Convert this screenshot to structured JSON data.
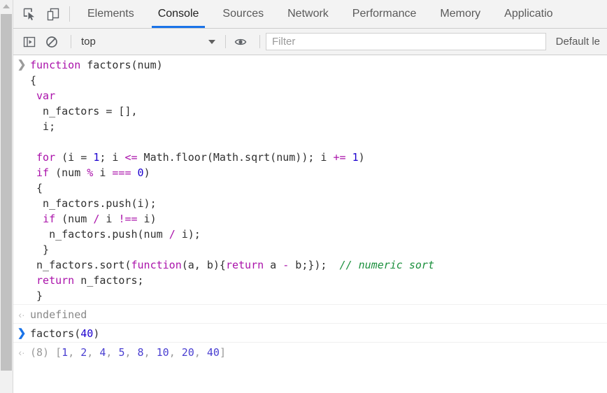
{
  "window": {
    "app": "Chrome DevTools"
  },
  "scrollbar": {
    "up_arrow_icon": "triangle-up-icon",
    "thumb": "scrollbar-thumb"
  },
  "tabbar": {
    "inspect_icon": "inspect-element-icon",
    "device_icon": "device-toolbar-icon",
    "tabs": [
      {
        "label": "Elements",
        "active": false
      },
      {
        "label": "Console",
        "active": true
      },
      {
        "label": "Sources",
        "active": false
      },
      {
        "label": "Network",
        "active": false
      },
      {
        "label": "Performance",
        "active": false
      },
      {
        "label": "Memory",
        "active": false
      },
      {
        "label": "Applicatio",
        "active": false
      }
    ],
    "active_underline_color": "#1a73e8"
  },
  "toolbar": {
    "sidebar_icon": "console-sidebar-icon",
    "clear_icon": "clear-console-icon",
    "context_selected": "top",
    "context_caret_icon": "chevron-down-icon",
    "eye_icon": "live-expression-eye-icon",
    "filter_placeholder": "Filter",
    "filter_value": "",
    "levels_label": "Default le"
  },
  "console": {
    "messages": [
      {
        "kind": "input",
        "prompt": "❯",
        "prompt_style": "gray",
        "lines": [
          [
            {
              "t": "function ",
              "c": "kw"
            },
            {
              "t": "factors(num)",
              "c": "pun"
            }
          ],
          [
            {
              "t": "{",
              "c": "pun"
            }
          ],
          [
            {
              "t": " ",
              "c": "pun"
            },
            {
              "t": "var",
              "c": "kw"
            }
          ],
          [
            {
              "t": "  n_factors = [],",
              "c": "pun"
            }
          ],
          [
            {
              "t": "  i;",
              "c": "pun"
            }
          ],
          [
            {
              "t": "",
              "c": "pun"
            }
          ],
          [
            {
              "t": " ",
              "c": "pun"
            },
            {
              "t": "for",
              "c": "kw"
            },
            {
              "t": " (i = ",
              "c": "pun"
            },
            {
              "t": "1",
              "c": "num"
            },
            {
              "t": "; i ",
              "c": "pun"
            },
            {
              "t": "<=",
              "c": "kw"
            },
            {
              "t": " Math.floor(Math.sqrt(num)); i ",
              "c": "pun"
            },
            {
              "t": "+=",
              "c": "kw"
            },
            {
              "t": " ",
              "c": "pun"
            },
            {
              "t": "1",
              "c": "num"
            },
            {
              "t": ")",
              "c": "pun"
            }
          ],
          [
            {
              "t": " ",
              "c": "pun"
            },
            {
              "t": "if",
              "c": "kw"
            },
            {
              "t": " (num ",
              "c": "pun"
            },
            {
              "t": "%",
              "c": "kw"
            },
            {
              "t": " i ",
              "c": "pun"
            },
            {
              "t": "===",
              "c": "kw"
            },
            {
              "t": " ",
              "c": "pun"
            },
            {
              "t": "0",
              "c": "num"
            },
            {
              "t": ")",
              "c": "pun"
            }
          ],
          [
            {
              "t": " {",
              "c": "pun"
            }
          ],
          [
            {
              "t": "  n_factors.push(i);",
              "c": "pun"
            }
          ],
          [
            {
              "t": "  ",
              "c": "pun"
            },
            {
              "t": "if",
              "c": "kw"
            },
            {
              "t": " (num ",
              "c": "pun"
            },
            {
              "t": "/",
              "c": "kw"
            },
            {
              "t": " i ",
              "c": "pun"
            },
            {
              "t": "!==",
              "c": "kw"
            },
            {
              "t": " i)",
              "c": "pun"
            }
          ],
          [
            {
              "t": "   n_factors.push(num ",
              "c": "pun"
            },
            {
              "t": "/",
              "c": "kw"
            },
            {
              "t": " i);",
              "c": "pun"
            }
          ],
          [
            {
              "t": "  }",
              "c": "pun"
            }
          ],
          [
            {
              "t": " n_factors.sort(",
              "c": "pun"
            },
            {
              "t": "function",
              "c": "kw"
            },
            {
              "t": "(a, b){",
              "c": "pun"
            },
            {
              "t": "return",
              "c": "kw"
            },
            {
              "t": " a ",
              "c": "pun"
            },
            {
              "t": "-",
              "c": "kw"
            },
            {
              "t": " b;});  ",
              "c": "pun"
            },
            {
              "t": "// numeric sort",
              "c": "cmt"
            }
          ],
          [
            {
              "t": " ",
              "c": "pun"
            },
            {
              "t": "return",
              "c": "kw"
            },
            {
              "t": " n_factors;",
              "c": "pun"
            }
          ],
          [
            {
              "t": " }",
              "c": "pun"
            }
          ]
        ]
      },
      {
        "kind": "output",
        "prompt": "‹·",
        "text": "undefined",
        "style": "gray"
      },
      {
        "kind": "input",
        "prompt": "❯",
        "prompt_style": "blue",
        "lines": [
          [
            {
              "t": "factors(",
              "c": "pun"
            },
            {
              "t": "40",
              "c": "num"
            },
            {
              "t": ")",
              "c": "pun"
            }
          ]
        ]
      },
      {
        "kind": "output-array",
        "prompt": "‹·",
        "count_label": "(8)",
        "open_bracket": "[",
        "close_bracket": "]",
        "separator": ", ",
        "values": [
          1,
          2,
          4,
          5,
          8,
          10,
          20,
          40
        ]
      }
    ]
  },
  "colors": {
    "accent": "#1a73e8",
    "keyword": "#aa12aa",
    "number": "#1c00cf",
    "comment": "#1a8f3c",
    "text": "#303030",
    "muted": "#888888",
    "toolbar_bg": "#f3f3f3"
  }
}
